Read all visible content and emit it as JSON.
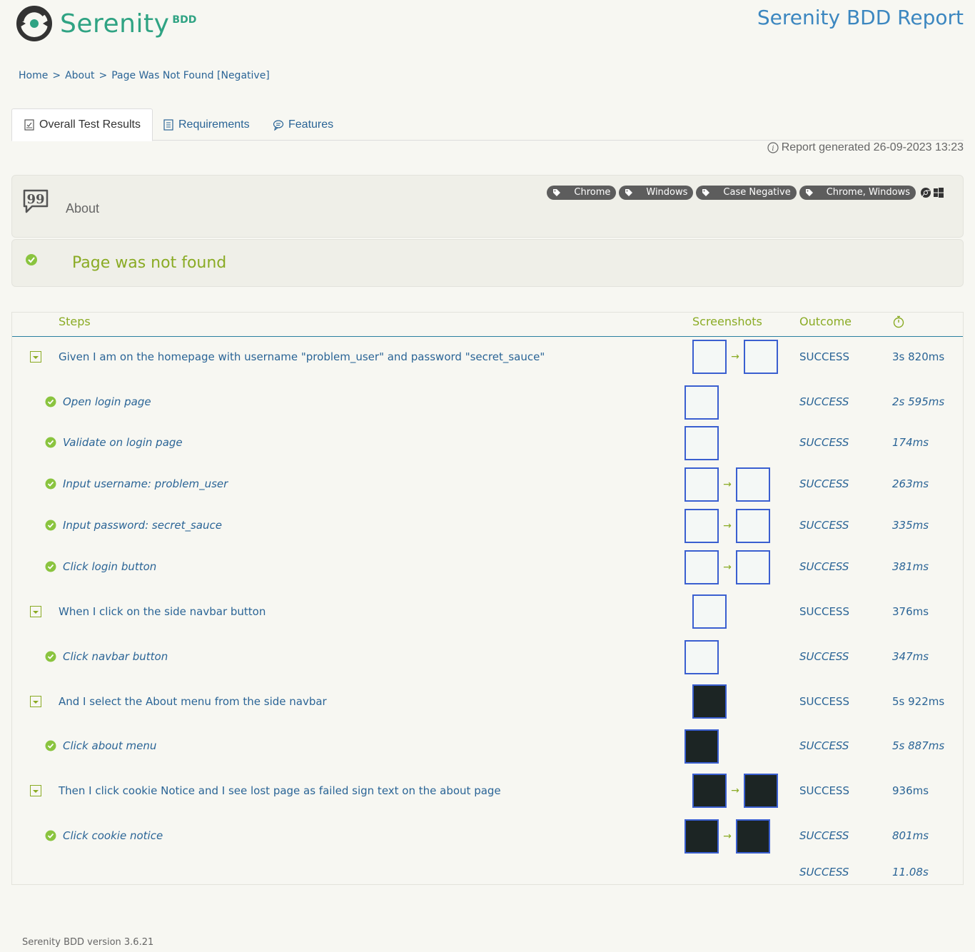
{
  "logo": {
    "name": "Serenity",
    "suffix": "BDD"
  },
  "report_title": "Serenity BDD Report",
  "breadcrumb": {
    "home": "Home",
    "sep": ">",
    "about": "About",
    "current": "Page Was Not Found [Negative]"
  },
  "tabs": [
    {
      "label": "Overall Test Results",
      "icon": "checklist-icon"
    },
    {
      "label": "Requirements",
      "icon": "list-icon"
    },
    {
      "label": "Features",
      "icon": "comment-icon"
    }
  ],
  "generated": "Report generated 26-09-2023 13:23",
  "feature": {
    "label": "About",
    "tags": [
      "Chrome",
      "Windows",
      "Case Negative",
      "Chrome, Windows"
    ]
  },
  "scenario_title": "Page was not found",
  "steps_table": {
    "headers": {
      "steps": "Steps",
      "screenshots": "Screenshots",
      "outcome": "Outcome"
    },
    "rows": [
      {
        "text": "Given I am on the homepage with username \"problem_user\" and password \"secret_sauce\"",
        "outcome": "SUCCESS",
        "duration": "3s 820ms"
      },
      {
        "text": "Open login page",
        "outcome": "SUCCESS",
        "duration": "2s 595ms"
      },
      {
        "text": "Validate on login page",
        "outcome": "SUCCESS",
        "duration": "174ms"
      },
      {
        "text": "Input username: problem_user",
        "outcome": "SUCCESS",
        "duration": "263ms"
      },
      {
        "text": "Input password: secret_sauce",
        "outcome": "SUCCESS",
        "duration": "335ms"
      },
      {
        "text": "Click login button",
        "outcome": "SUCCESS",
        "duration": "381ms"
      },
      {
        "text": "When I click on the side navbar button",
        "outcome": "SUCCESS",
        "duration": "376ms"
      },
      {
        "text": "Click navbar button",
        "outcome": "SUCCESS",
        "duration": "347ms"
      },
      {
        "text": "And I select the About menu from the side navbar",
        "outcome": "SUCCESS",
        "duration": "5s 922ms"
      },
      {
        "text": "Click about menu",
        "outcome": "SUCCESS",
        "duration": "5s 887ms"
      },
      {
        "text": "Then I click cookie Notice and I see lost page as failed sign text on the about page",
        "outcome": "SUCCESS",
        "duration": "936ms"
      },
      {
        "text": "Click cookie notice",
        "outcome": "SUCCESS",
        "duration": "801ms"
      }
    ],
    "total": {
      "outcome": "SUCCESS",
      "duration": "11.08s"
    }
  },
  "arrow": "→",
  "footer": "Serenity BDD version 3.6.21",
  "colors": {
    "accent_green": "#8aab24",
    "link_blue": "#2a6496",
    "brand_teal": "#2fa383",
    "title_blue": "#3c87c0"
  }
}
